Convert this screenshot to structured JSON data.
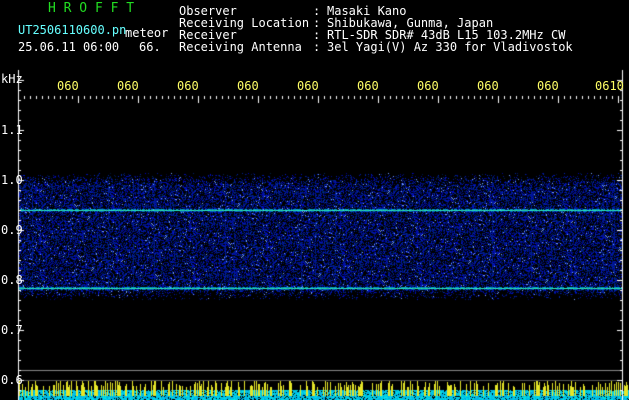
{
  "header": {
    "brand": "H R O F F T",
    "filename": "UT2506110600.pn",
    "file_tag": "meteor",
    "datetime": "25.06.11 06:00",
    "count": "66.",
    "fields": [
      {
        "label": "Observer",
        "value": "Masaki Kano"
      },
      {
        "label": "Receiving Location",
        "value": "Shibukawa, Gunma, Japan"
      },
      {
        "label": "Receiver",
        "value": "RTL-SDR SDR# 43dB L15 103.2MHz CW"
      },
      {
        "label": "Receiving Antenna",
        "value": "3el Yagi(V) Az 330 for Vladivostok"
      }
    ],
    "separator": ":"
  },
  "plot": {
    "unit_label": "kHz",
    "y_ticks": [
      "1.1",
      "1.0",
      "0.9",
      "0.8",
      "0.7",
      "0.6"
    ],
    "time_ticks": [
      "060",
      "060",
      "060",
      "060",
      "060",
      "060",
      "060",
      "060",
      "060",
      "0610"
    ]
  },
  "colors": {
    "background": "#000000",
    "text": "#ffffff",
    "brand": "#22dd22",
    "filename": "#66ffff",
    "time_ticks": "#ffff66",
    "echo_band": "#44ddaa"
  }
}
